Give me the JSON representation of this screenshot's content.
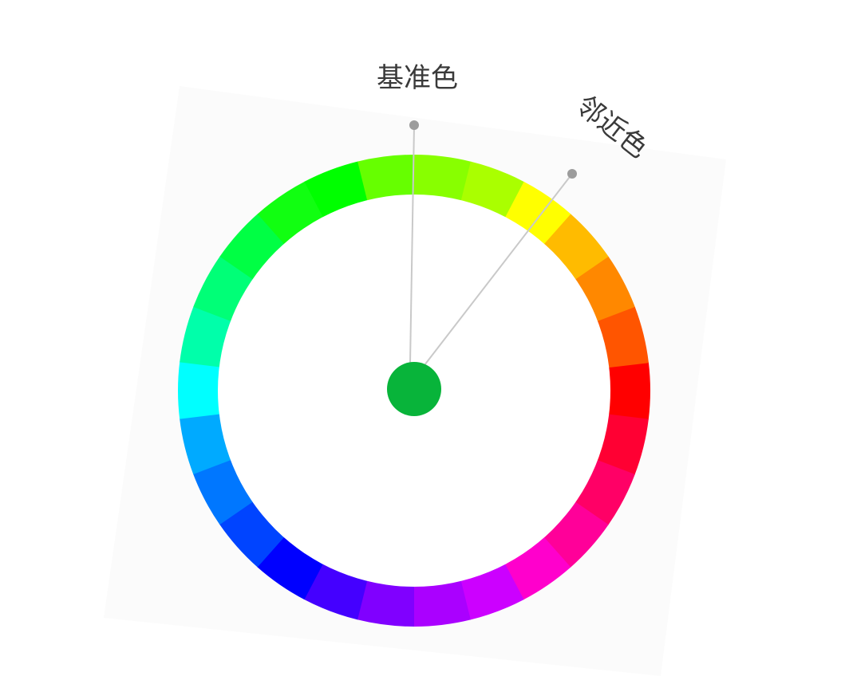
{
  "labels": {
    "base_color": "基准色",
    "adjacent_color": "邻近色"
  },
  "colors": {
    "center_dot": "#08b43a",
    "pointer_line": "#c9c9c9",
    "pointer_dot": "#9c9c9c",
    "backdrop": "#fbfbfb",
    "wheel_segments": [
      "#ff0000",
      "#ff0033",
      "#ff0066",
      "#ff0099",
      "#ff00cc",
      "#cc00ff",
      "#aa00ff",
      "#8000ff",
      "#4400ff",
      "#0000ff",
      "#0044ff",
      "#0077ff",
      "#00aaff",
      "#00ffff",
      "#00ffaa",
      "#00ff77",
      "#00ff44",
      "#11ff11",
      "#00ff00",
      "#66ff00",
      "#88ff00",
      "#aaff00",
      "#ffff00",
      "#ffbb00",
      "#ff8800",
      "#ff5500"
    ]
  }
}
